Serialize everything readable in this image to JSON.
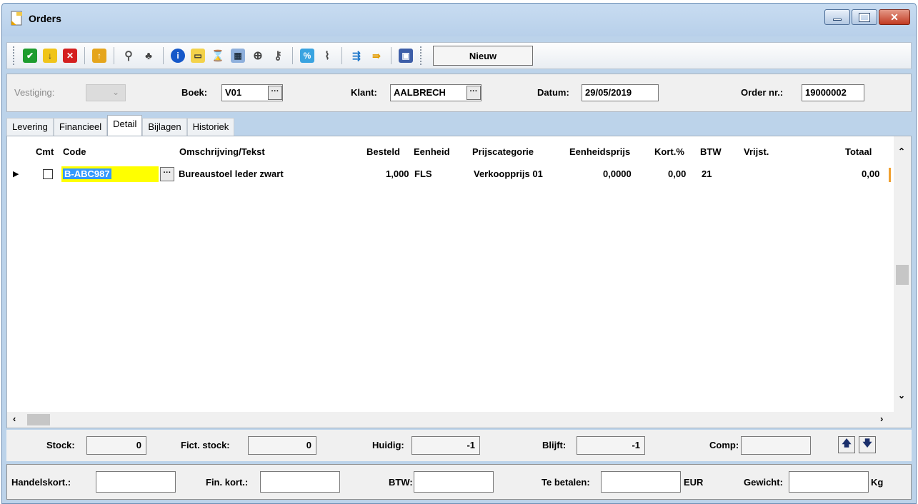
{
  "window": {
    "title": "Orders"
  },
  "toolbar": {
    "new_label": "Nieuw"
  },
  "header": {
    "vestiging_label": "Vestiging:",
    "boek_label": "Boek:",
    "boek_value": "V01",
    "klant_label": "Klant:",
    "klant_value": "AALBRECH",
    "datum_label": "Datum:",
    "datum_value": "29/05/2019",
    "order_label": "Order nr.:",
    "order_value": "19000002"
  },
  "tabs": [
    "Levering",
    "Financieel",
    "Detail",
    "Bijlagen",
    "Historiek"
  ],
  "grid": {
    "columns": [
      "Cmt",
      "Code",
      "Omschrijving/Tekst",
      "Besteld",
      "Eenheid",
      "Prijscategorie",
      "Eenheidsprijs",
      "Kort.%",
      "BTW",
      "Vrijst.",
      "Totaal"
    ],
    "rows": [
      {
        "code": "B-ABC987",
        "description": "Bureaustoel leder zwart",
        "besteld": "1,000",
        "eenheid": "FLS",
        "prijscategorie": "Verkoopprijs 01",
        "eenheidsprijs": "0,0000",
        "kort": "0,00",
        "btw": "21",
        "vrijst": "",
        "totaal": "0,00"
      }
    ]
  },
  "stats": {
    "stock_label": "Stock:",
    "stock_value": "0",
    "fict_label": "Fict. stock:",
    "fict_value": "0",
    "huidig_label": "Huidig:",
    "huidig_value": "-1",
    "blijft_label": "Blijft:",
    "blijft_value": "-1",
    "comp_label": "Comp:"
  },
  "footer": {
    "handelskort_label": "Handelskort.:",
    "finkort_label": "Fin. kort.:",
    "btw_label": "BTW:",
    "tebetalen_label": "Te betalen:",
    "currency": "EUR",
    "gewicht_label": "Gewicht:",
    "unit": "Kg"
  },
  "colors": {
    "title_bg": "#bcd3ea",
    "close_red": "#c23b22",
    "selection_yellow": "#ffff00",
    "selection_blue": "#3399ff"
  }
}
